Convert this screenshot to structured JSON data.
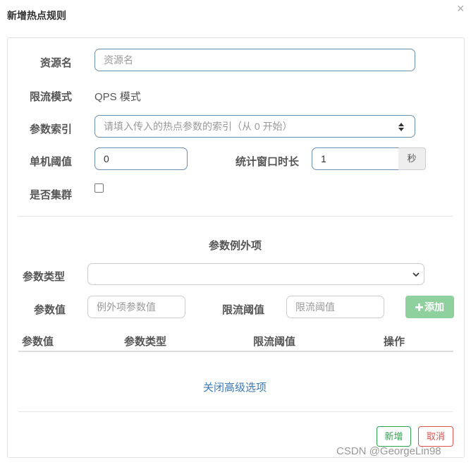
{
  "dialog": {
    "title": "新增热点规则",
    "close_glyph": "×"
  },
  "form": {
    "resource_label": "资源名",
    "resource_placeholder": "资源名",
    "mode_label": "限流模式",
    "mode_value": "QPS 模式",
    "param_index_label": "参数索引",
    "param_index_placeholder": "请填入传入的热点参数的索引（从 0 开始）",
    "threshold_label": "单机阈值",
    "threshold_value": "0",
    "window_label": "统计窗口时长",
    "window_value": "1",
    "window_unit": "秒",
    "cluster_label": "是否集群",
    "cluster_checked": false
  },
  "exceptions": {
    "section_title": "参数例外项",
    "type_label": "参数类型",
    "type_value": "",
    "value_label": "参数值",
    "value_placeholder": "例外项参数值",
    "limit_label": "限流阈值",
    "limit_placeholder": "限流阈值",
    "add_button": "添加",
    "add_icon": "plus-icon",
    "table_headers": [
      "参数值",
      "参数类型",
      "限流阈值",
      "操作"
    ],
    "rows": []
  },
  "advanced_toggle": "关闭高级选项",
  "footer": {
    "new_button": "新增",
    "cancel_button": "取消"
  },
  "watermark": "CSDN @GeorgeLin98",
  "colors": {
    "input_border": "#6b8fb0",
    "add_button_bg": "#8fd19e",
    "link": "#3c7ab6",
    "success": "#2ea44f",
    "danger": "#d9534f"
  }
}
